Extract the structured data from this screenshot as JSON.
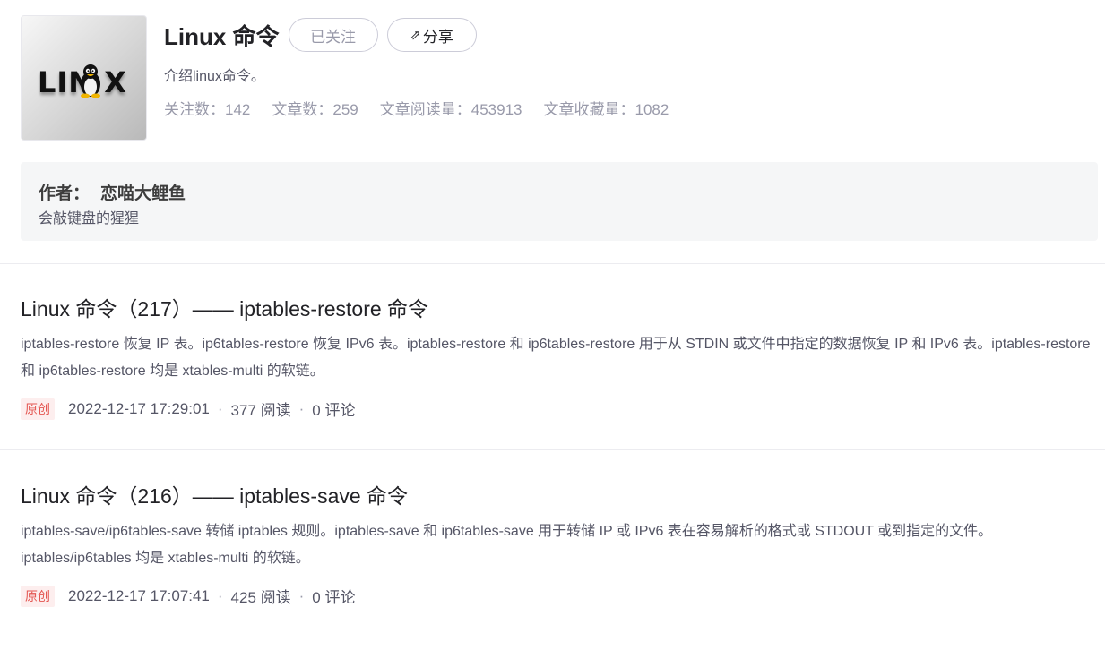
{
  "column": {
    "cover_text": "LIN X",
    "title": "Linux 命令",
    "follow_label": "已关注",
    "share_label": "分享",
    "description": "介绍linux命令。",
    "stats": {
      "followers": "关注数：142",
      "articles": "文章数：259",
      "reads": "文章阅读量：453913",
      "favorites": "文章收藏量：1082"
    }
  },
  "author": {
    "label": "作者：",
    "name": "恋喵大鲤鱼",
    "bio": "会敲键盘的猩猩"
  },
  "articles": [
    {
      "title": "Linux 命令（217）—— iptables-restore 命令",
      "description": "iptables-restore 恢复 IP 表。ip6tables-restore 恢复 IPv6 表。iptables-restore 和 ip6tables-restore 用于从 STDIN 或文件中指定的数据恢复 IP 和 IPv6 表。iptables-restore 和 ip6tables-restore 均是 xtables-multi 的软链。",
      "badge": "原创",
      "date": "2022-12-17 17:29:01",
      "reads": "377 阅读",
      "comments": "0 评论"
    },
    {
      "title": "Linux 命令（216）—— iptables-save 命令",
      "description": "iptables-save/ip6tables-save 转储 iptables 规则。iptables-save 和 ip6tables-save 用于转储 IP 或 IPv6 表在容易解析的格式或 STDOUT 或到指定的文件。iptables/ip6tables 均是 xtables-multi 的软链。",
      "badge": "原创",
      "date": "2022-12-17 17:07:41",
      "reads": "425 阅读",
      "comments": "0 评论"
    }
  ]
}
